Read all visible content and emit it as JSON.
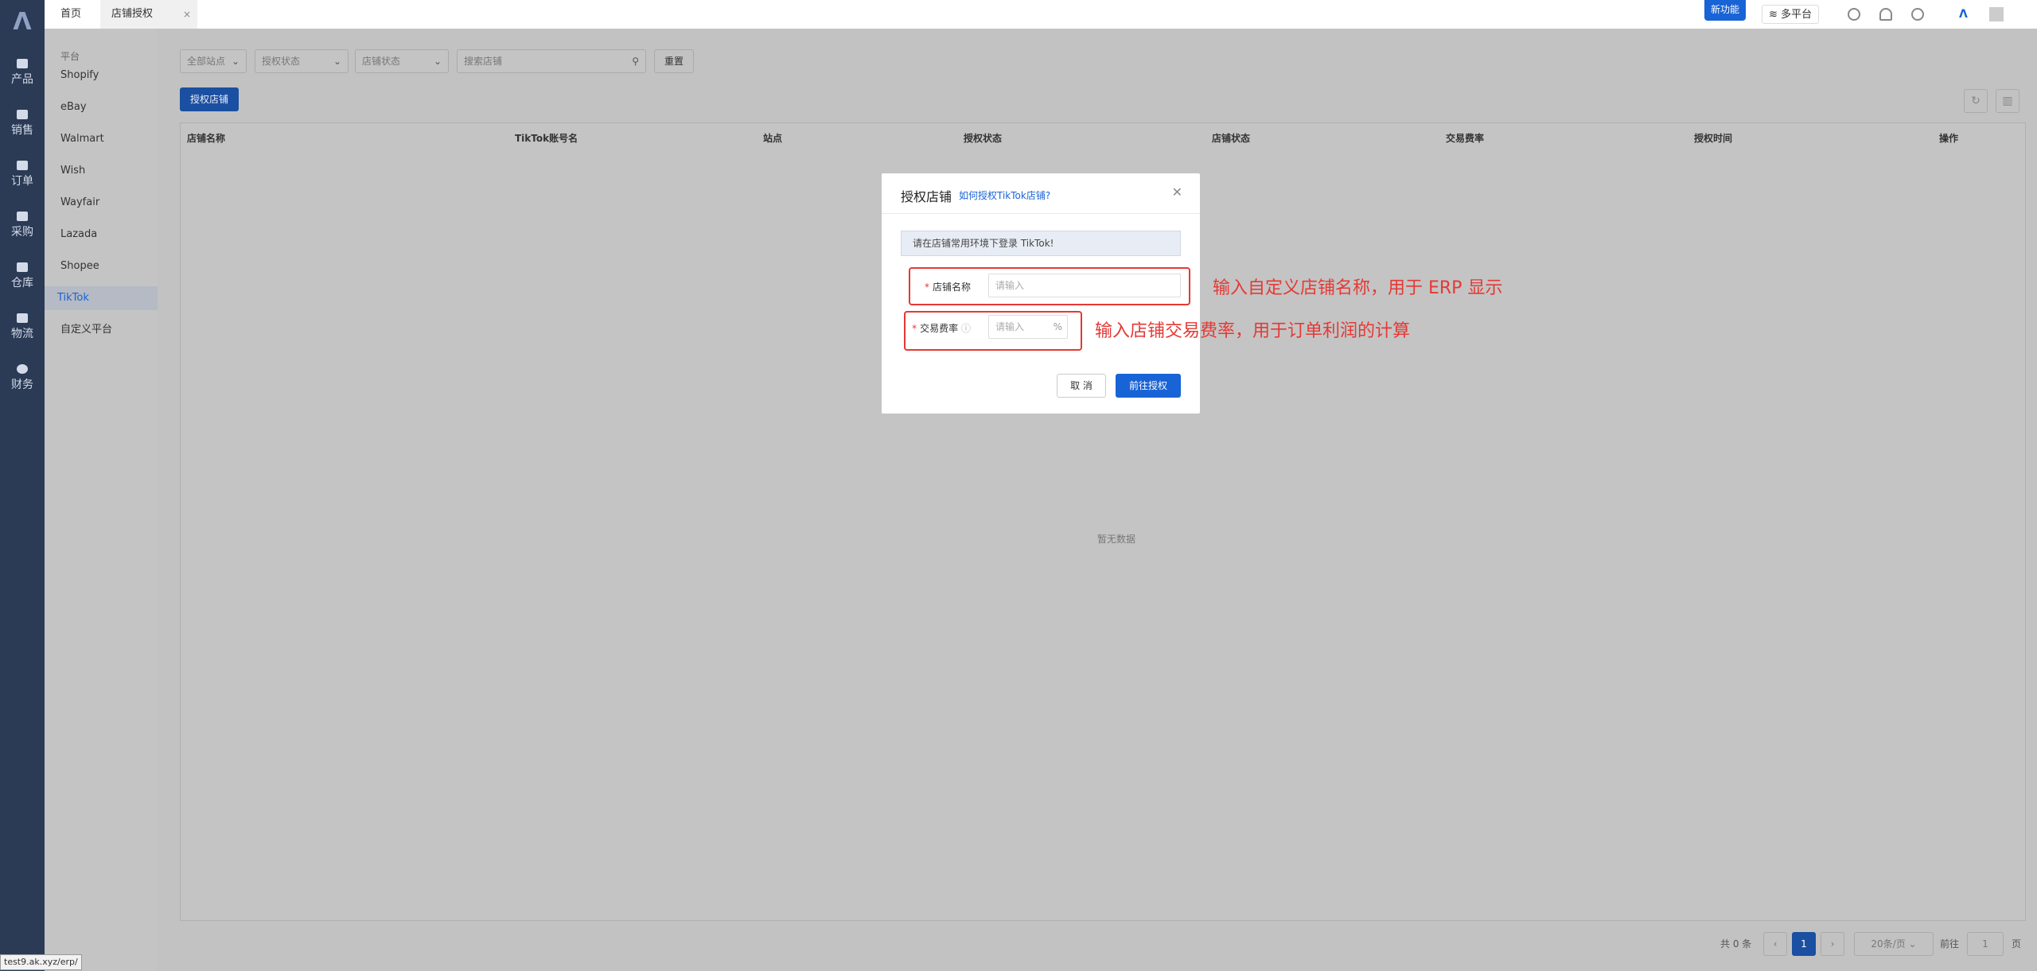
{
  "sidebar": {
    "items": [
      {
        "label": "产品",
        "icon": "product-icon"
      },
      {
        "label": "销售",
        "icon": "sales-icon"
      },
      {
        "label": "订单",
        "icon": "order-icon"
      },
      {
        "label": "采购",
        "icon": "cart-icon"
      },
      {
        "label": "仓库",
        "icon": "warehouse-icon"
      },
      {
        "label": "物流",
        "icon": "truck-icon"
      },
      {
        "label": "财务",
        "icon": "finance-icon"
      }
    ]
  },
  "topbar": {
    "tabs": [
      {
        "label": "首页"
      },
      {
        "label": "店铺授权",
        "close": "×"
      }
    ],
    "new_feature": "新功能",
    "multi_platform": "多平台"
  },
  "subnav": {
    "title": "平台",
    "items": [
      "Shopify",
      "eBay",
      "Walmart",
      "Wish",
      "Wayfair",
      "Lazada",
      "Shopee",
      "TikTok",
      "自定义平台"
    ],
    "active": "TikTok"
  },
  "filters": {
    "site": "全部站点",
    "auth_status": "授权状态",
    "shop_status": "店铺状态",
    "search_placeholder": "搜索店铺",
    "reset": "重置"
  },
  "auth_button": "授权店铺",
  "table": {
    "columns": [
      "店铺名称",
      "TikTok账号名",
      "站点",
      "授权状态",
      "店铺状态",
      "交易费率",
      "授权时间",
      "操作"
    ],
    "empty_text": "暂无数据"
  },
  "pagination": {
    "total": "共 0 条",
    "current_page": "1",
    "page_size": "20条/页",
    "goto_label": "前往",
    "goto_value": "1",
    "page_suffix": "页"
  },
  "modal": {
    "title": "授权店铺",
    "help_link": "如何授权TikTok店铺?",
    "tip": "请在店铺常用环境下登录 TikTok!",
    "shop_name_label": "店铺名称",
    "shop_name_placeholder": "请输入",
    "fee_label": "交易费率",
    "fee_placeholder": "请输入",
    "fee_unit": "%",
    "cancel": "取 消",
    "confirm": "前往授权"
  },
  "annotations": {
    "shop_name": "输入自定义店铺名称，用于 ERP 显示",
    "fee": "输入店铺交易费率，用于订单利润的计算"
  },
  "status_url": "test9.ak.xyz/erp/",
  "colors": {
    "primary": "#1863d6",
    "sidebar": "#2b3a55",
    "annotation": "#e53935"
  }
}
